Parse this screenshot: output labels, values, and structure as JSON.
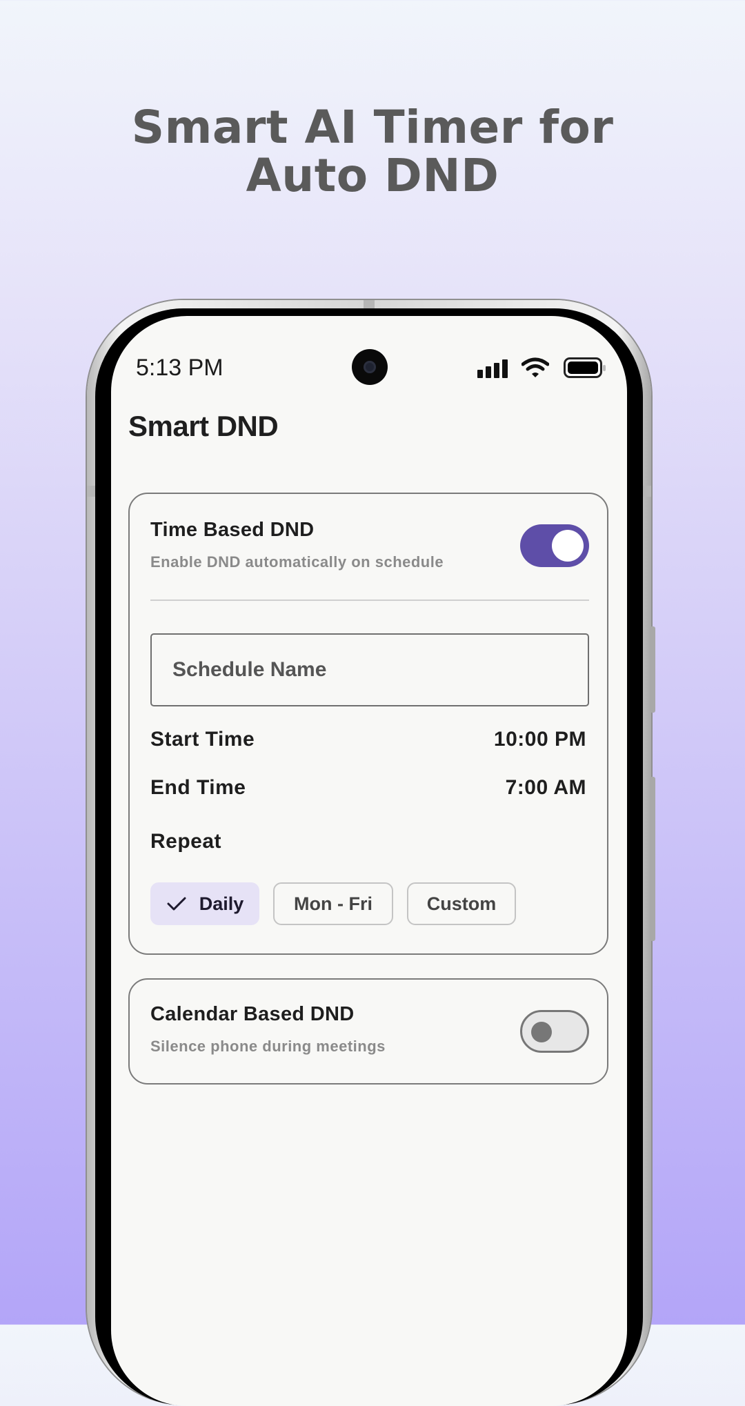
{
  "headline": {
    "line1": "Smart AI Timer for",
    "line2": "Auto DND"
  },
  "status_bar": {
    "time": "5:13 PM"
  },
  "app": {
    "title": "Smart DND"
  },
  "time_card": {
    "title": "Time Based DND",
    "subtitle": "Enable DND automatically on schedule",
    "toggle_on": true,
    "schedule_placeholder": "Schedule Name",
    "start_label": "Start Time",
    "start_value": "10:00 PM",
    "end_label": "End Time",
    "end_value": "7:00 AM",
    "repeat_label": "Repeat",
    "chips": [
      {
        "label": "Daily",
        "selected": true
      },
      {
        "label": "Mon - Fri",
        "selected": false
      },
      {
        "label": "Custom",
        "selected": false
      }
    ]
  },
  "calendar_card": {
    "title": "Calendar Based DND",
    "subtitle": "Silence phone during meetings",
    "toggle_on": false
  },
  "colors": {
    "accent": "#5e4ea8",
    "chip_selected_bg": "#e6e2f6",
    "headline": "#5a5a5a"
  },
  "icons": [
    "signal-icon",
    "wifi-icon",
    "battery-icon",
    "check-icon",
    "camera-icon"
  ]
}
